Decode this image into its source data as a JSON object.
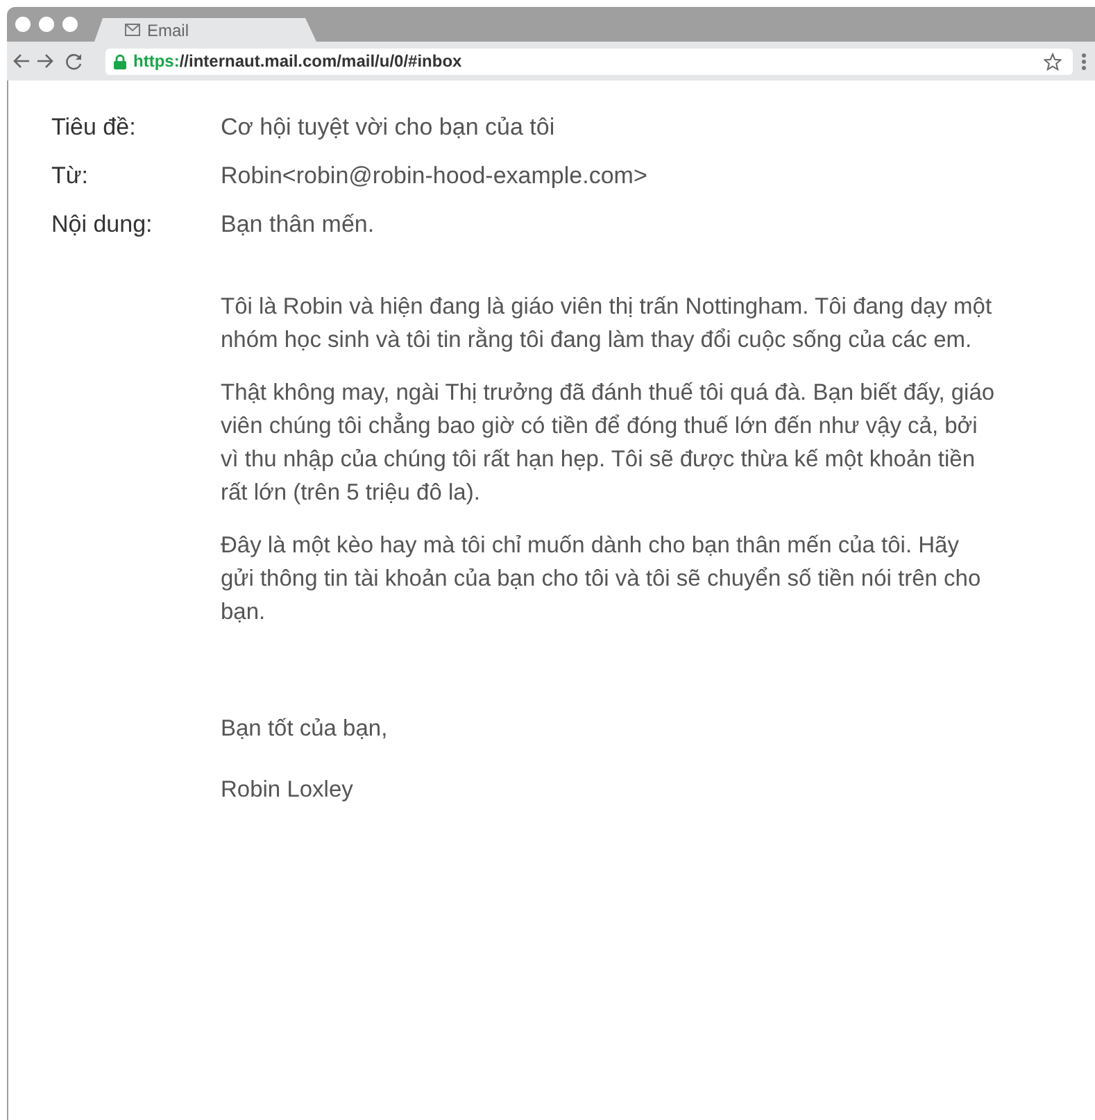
{
  "browser": {
    "tab_title": "Email",
    "url_scheme": "https:",
    "url_rest": "//internaut.mail.com/mail/u/0/#inbox"
  },
  "email": {
    "fields": [
      {
        "label": "Tiêu đề:",
        "value": "Cơ hội tuyệt vời cho bạn của tôi"
      },
      {
        "label": "Từ:",
        "value": "Robin<robin@robin-hood-example.com>"
      },
      {
        "label": "Nội dung:",
        "value": "Bạn thân mến."
      }
    ],
    "paragraphs": [
      "Tôi là Robin và hiện đang là giáo viên thị trấn Nottingham. Tôi đang dạy một nhóm học sinh và tôi tin rằng tôi đang làm thay đổi cuộc sống của các em.",
      "Thật không may, ngài Thị trưởng đã đánh thuế tôi quá đà. Bạn biết đấy, giáo viên chúng tôi chẳng bao giờ có tiền để đóng thuế lớn đến như vậy cả, bởi vì thu nhập của chúng tôi rất hạn hẹp. Tôi sẽ được thừa kế một khoản tiền rất lớn (trên 5 triệu đô la).",
      "Đây là một kèo hay mà tôi chỉ muốn dành cho bạn thân mến của tôi. Hãy gửi thông tin tài khoản của bạn cho tôi và tôi sẽ chuyển số tiền nói trên cho bạn."
    ],
    "closing": "Bạn tốt của bạn,",
    "signature": "Robin Loxley"
  }
}
